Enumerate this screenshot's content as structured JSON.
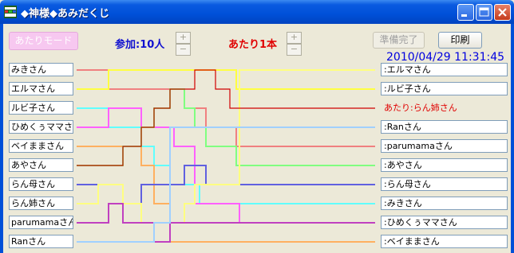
{
  "window": {
    "title": "◆神様◆あみだくじ",
    "icon": "app-grid-icon",
    "controls": [
      "minimize-icon",
      "maximize-icon",
      "close-icon"
    ]
  },
  "toolbar": {
    "atari_mode_label": "あたりモード",
    "sanka_label": "参加:10人",
    "atari_count_label": "あたり1本",
    "spin_up": "+",
    "spin_down": "−",
    "ready_label": "準備完了",
    "print_label": "印刷"
  },
  "datetime": "2010/04/29 11:31:45",
  "colors": {
    "title_bar": "#0050D8",
    "window_bg": "#ECE9D8",
    "sanka_text": "#1010D0",
    "atari_text": "#E00000",
    "datetime_text": "#0000E0"
  },
  "participants": [
    "みきさん",
    "エルマさん",
    "ルビ子さん",
    "ひめくぅママさん",
    "ベイままさん",
    "あやさん",
    "らん母さん",
    "らん姉さん",
    "parumamaさん",
    "Ranさん"
  ],
  "results": [
    ":エルマさん",
    ":ルビ子さん",
    "あたり:らん姉さん",
    ":Ranさん",
    ":parumamaさん",
    ":あやさん",
    ":らん母さん",
    ":みきさん",
    ":ひめくぅママさん",
    ":ベイままさん"
  ],
  "lines": {
    "colors": [
      "#F08080",
      "#FFFF40",
      "#60FFFF",
      "#FF60FF",
      "#FFB060",
      "#80FF80",
      "#6060E0",
      "#FFFF80",
      "#C040C0",
      "#A0D0FF"
    ],
    "red": "#D00000"
  }
}
